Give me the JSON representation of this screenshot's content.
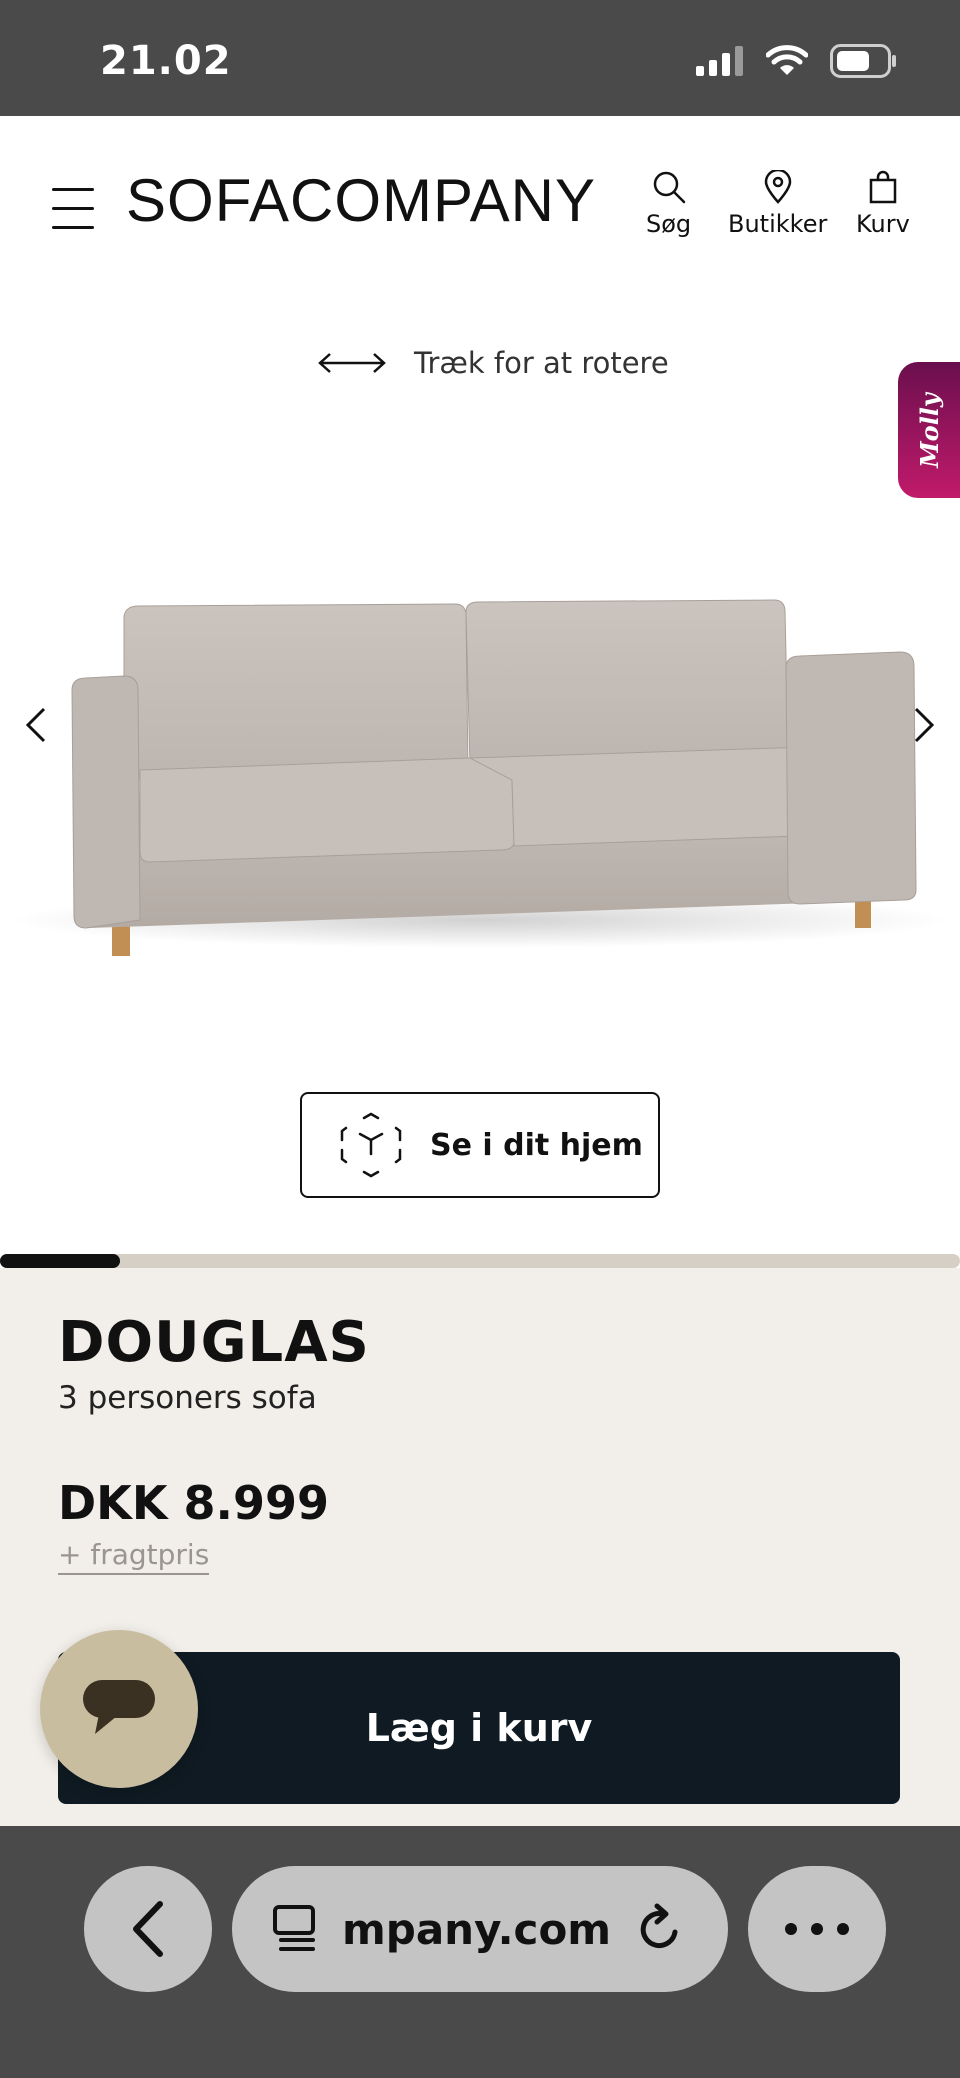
{
  "status_bar": {
    "time": "21.02"
  },
  "header": {
    "logo": "SOFACOMPANY",
    "nav": {
      "search_label": "Søg",
      "stores_label": "Butikker",
      "cart_label": "Kurv"
    }
  },
  "viewer": {
    "rotate_hint": "Træk for at rotere",
    "molly_label": "Molly",
    "ar_button_label": "Se i dit hjem",
    "gallery_progress": 0.125
  },
  "product": {
    "name": "DOUGLAS",
    "subtitle": "3 personers sofa",
    "price": "DKK 8.999",
    "shipping_link": "+ fragtpris",
    "add_to_cart_label": "Læg i kurv"
  },
  "browser": {
    "url": "mpany.com"
  },
  "colors": {
    "brand_dark": "#0f1a22",
    "info_background": "#f2efea",
    "chat_bubble": "#c9bda0",
    "molly_gradient_start": "#6a0f4e",
    "molly_gradient_end": "#c11a6a",
    "browser_chrome": "#4a4a4a"
  },
  "icons": {
    "menu": "hamburger-icon",
    "search": "search-icon",
    "stores": "location-pin-icon",
    "cart": "shopping-bag-icon",
    "rotate": "double-arrow-icon",
    "ar": "ar-cube-icon",
    "chat": "chat-icon",
    "back": "chevron-left-icon",
    "tabs": "tabs-icon",
    "reload": "reload-icon",
    "more": "more-icon"
  }
}
